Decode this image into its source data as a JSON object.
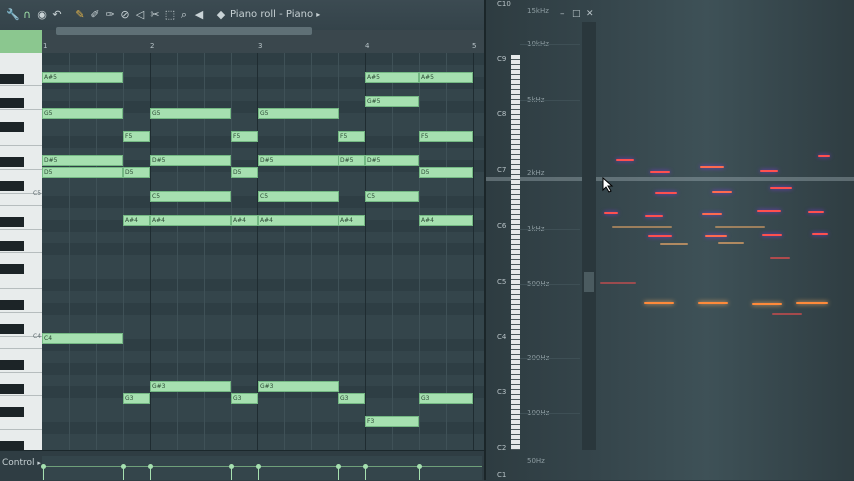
{
  "window": {
    "title": "Piano roll - Piano"
  },
  "toolbar": {
    "icons": [
      "wrench-icon",
      "magnet-icon",
      "record-icon",
      "undo-icon",
      "pencil-icon",
      "brush-icon",
      "erase-icon",
      "mute-icon",
      "delete-icon",
      "slice-icon",
      "select-icon",
      "zoom-icon",
      "speaker-icon"
    ],
    "title_chevron": "▸"
  },
  "ruler": {
    "bars": [
      "1",
      "2",
      "3",
      "4",
      "5"
    ]
  },
  "keyboard": {
    "labels": [
      "C5",
      "C4"
    ]
  },
  "notes": [
    {
      "label": "A#5"
    },
    {
      "label": "A#5"
    },
    {
      "label": "A#5"
    },
    {
      "label": "G#5"
    },
    {
      "label": "G5"
    },
    {
      "label": "G5"
    },
    {
      "label": "G5"
    },
    {
      "label": "F5"
    },
    {
      "label": "F5"
    },
    {
      "label": "F5"
    },
    {
      "label": "F5"
    },
    {
      "label": "D#5"
    },
    {
      "label": "D#5"
    },
    {
      "label": "D#5"
    },
    {
      "label": "D#5"
    },
    {
      "label": "D#5"
    },
    {
      "label": "D5"
    },
    {
      "label": "D5"
    },
    {
      "label": "D5"
    },
    {
      "label": "D5"
    },
    {
      "label": "C5"
    },
    {
      "label": "C5"
    },
    {
      "label": "C5"
    },
    {
      "label": "A#4"
    },
    {
      "label": "A#4"
    },
    {
      "label": "A#4"
    },
    {
      "label": "A#4"
    },
    {
      "label": "A#4"
    },
    {
      "label": "A#4"
    },
    {
      "label": "C4"
    },
    {
      "label": "G#3"
    },
    {
      "label": "G#3"
    },
    {
      "label": "G3"
    },
    {
      "label": "G3"
    },
    {
      "label": "G3"
    },
    {
      "label": "G3"
    },
    {
      "label": "F3"
    }
  ],
  "control": {
    "label": "Control",
    "arrow": "▸"
  },
  "analyzer": {
    "octaves": [
      "C10",
      "C9",
      "C8",
      "C7",
      "C6",
      "C5",
      "C4",
      "C3",
      "C2",
      "C1"
    ],
    "freqs": [
      "15kHz",
      "10kHz",
      "5kHz",
      "2kHz",
      "1kHz",
      "500Hz",
      "200Hz",
      "100Hz",
      "50Hz"
    ],
    "window_buttons": [
      "–",
      "□",
      "✕"
    ],
    "colors": {
      "peak": "#ff5a4a",
      "glow": "#7a3bd6",
      "accent": "#ffb36a"
    }
  }
}
